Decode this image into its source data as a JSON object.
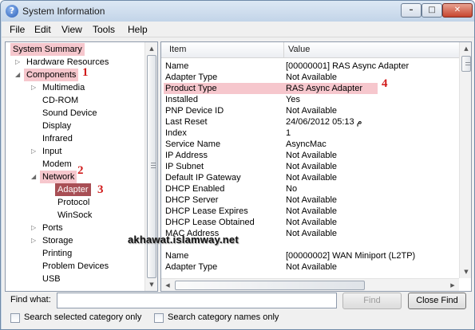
{
  "window": {
    "title": "System Information",
    "controls": {
      "minimize": "–",
      "maximize": "□",
      "close": "✕"
    }
  },
  "menu": [
    "File",
    "Edit",
    "View",
    "Tools",
    "Help"
  ],
  "tree": {
    "items": [
      {
        "label": "System Summary",
        "arrow": ""
      },
      {
        "label": "Hardware Resources",
        "arrow": "▷"
      },
      {
        "label": "Components",
        "arrow": "◢"
      },
      {
        "label": "Multimedia",
        "arrow": "▷"
      },
      {
        "label": "CD-ROM",
        "arrow": ""
      },
      {
        "label": "Sound Device",
        "arrow": ""
      },
      {
        "label": "Display",
        "arrow": ""
      },
      {
        "label": "Infrared",
        "arrow": ""
      },
      {
        "label": "Input",
        "arrow": "▷"
      },
      {
        "label": "Modem",
        "arrow": ""
      },
      {
        "label": "Network",
        "arrow": "◢"
      },
      {
        "label": "Adapter",
        "arrow": ""
      },
      {
        "label": "Protocol",
        "arrow": ""
      },
      {
        "label": "WinSock",
        "arrow": ""
      },
      {
        "label": "Ports",
        "arrow": "▷"
      },
      {
        "label": "Storage",
        "arrow": "▷"
      },
      {
        "label": "Printing",
        "arrow": ""
      },
      {
        "label": "Problem Devices",
        "arrow": ""
      },
      {
        "label": "USB",
        "arrow": ""
      }
    ]
  },
  "list": {
    "columns": {
      "item": "Item",
      "value": "Value"
    },
    "rows": [
      {
        "item": "Name",
        "value": "[00000001] RAS Async Adapter"
      },
      {
        "item": "Adapter Type",
        "value": "Not Available"
      },
      {
        "item": "Product Type",
        "value": "RAS Async Adapter"
      },
      {
        "item": "Installed",
        "value": "Yes"
      },
      {
        "item": "PNP Device ID",
        "value": "Not Available"
      },
      {
        "item": "Last Reset",
        "value": "24/06/2012 05:13 م"
      },
      {
        "item": "Index",
        "value": "1"
      },
      {
        "item": "Service Name",
        "value": "AsyncMac"
      },
      {
        "item": "IP Address",
        "value": "Not Available"
      },
      {
        "item": "IP Subnet",
        "value": "Not Available"
      },
      {
        "item": "Default IP Gateway",
        "value": "Not Available"
      },
      {
        "item": "DHCP Enabled",
        "value": "No"
      },
      {
        "item": "DHCP Server",
        "value": "Not Available"
      },
      {
        "item": "DHCP Lease Expires",
        "value": "Not Available"
      },
      {
        "item": "DHCP Lease Obtained",
        "value": "Not Available"
      },
      {
        "item": "MAC Address",
        "value": "Not Available"
      },
      {
        "item": "",
        "value": ""
      },
      {
        "item": "Name",
        "value": "[00000002] WAN Miniport (L2TP)"
      },
      {
        "item": "Adapter Type",
        "value": "Not Available"
      }
    ]
  },
  "find": {
    "label": "Find what:",
    "value": "",
    "find_button": "Find",
    "close_button": "Close Find",
    "check_selected": "Search selected category only",
    "check_names": "Search category names only"
  },
  "annotations": [
    "1",
    "2",
    "3",
    "4"
  ],
  "watermark": "akhawat.islamway.net",
  "colors": {
    "highlight": "#f6c7cd",
    "selection": "#a84f55",
    "annotation": "#d11b1b"
  }
}
